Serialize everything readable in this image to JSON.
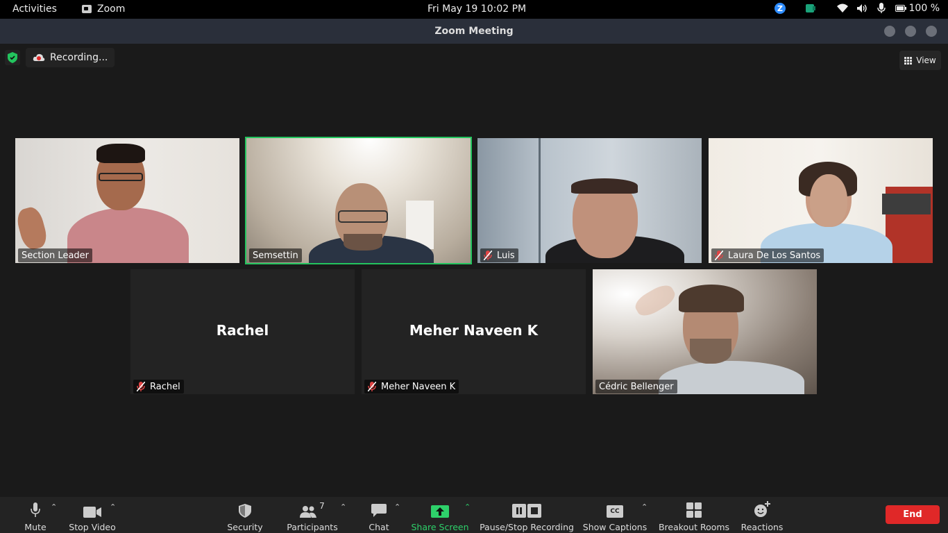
{
  "topbar": {
    "activities": "Activities",
    "app_name": "Zoom",
    "clock": "Fri May 19  10:02 PM",
    "battery": "100 %"
  },
  "window": {
    "title": "Zoom Meeting"
  },
  "meeting": {
    "recording_label": "Recording...",
    "view_label": "View"
  },
  "participants": [
    {
      "name": "Section Leader",
      "muted": false,
      "video": true
    },
    {
      "name": "Semsettin",
      "muted": false,
      "video": true,
      "active_speaker": true
    },
    {
      "name": "Luis",
      "muted": true,
      "video": true
    },
    {
      "name": "Laura De Los Santos",
      "muted": true,
      "video": true
    },
    {
      "name": "Rachel",
      "muted": true,
      "video": false,
      "display_name": "Rachel"
    },
    {
      "name": "Meher Naveen K",
      "muted": true,
      "video": false,
      "display_name": "Meher Naveen K"
    },
    {
      "name": "Cédric Bellenger",
      "muted": false,
      "video": true
    }
  ],
  "toolbar": {
    "mute": "Mute",
    "stop_video": "Stop Video",
    "security": "Security",
    "participants": "Participants",
    "participants_count": "7",
    "chat": "Chat",
    "share_screen": "Share Screen",
    "pause_stop_recording": "Pause/Stop Recording",
    "show_captions": "Show Captions",
    "captions_badge": "CC",
    "breakout_rooms": "Breakout Rooms",
    "reactions": "Reactions",
    "end": "End"
  },
  "colors": {
    "active_speaker": "#23c45e",
    "end_button": "#e02828",
    "share_green": "#2ed06a",
    "mute_red": "#e04545"
  }
}
